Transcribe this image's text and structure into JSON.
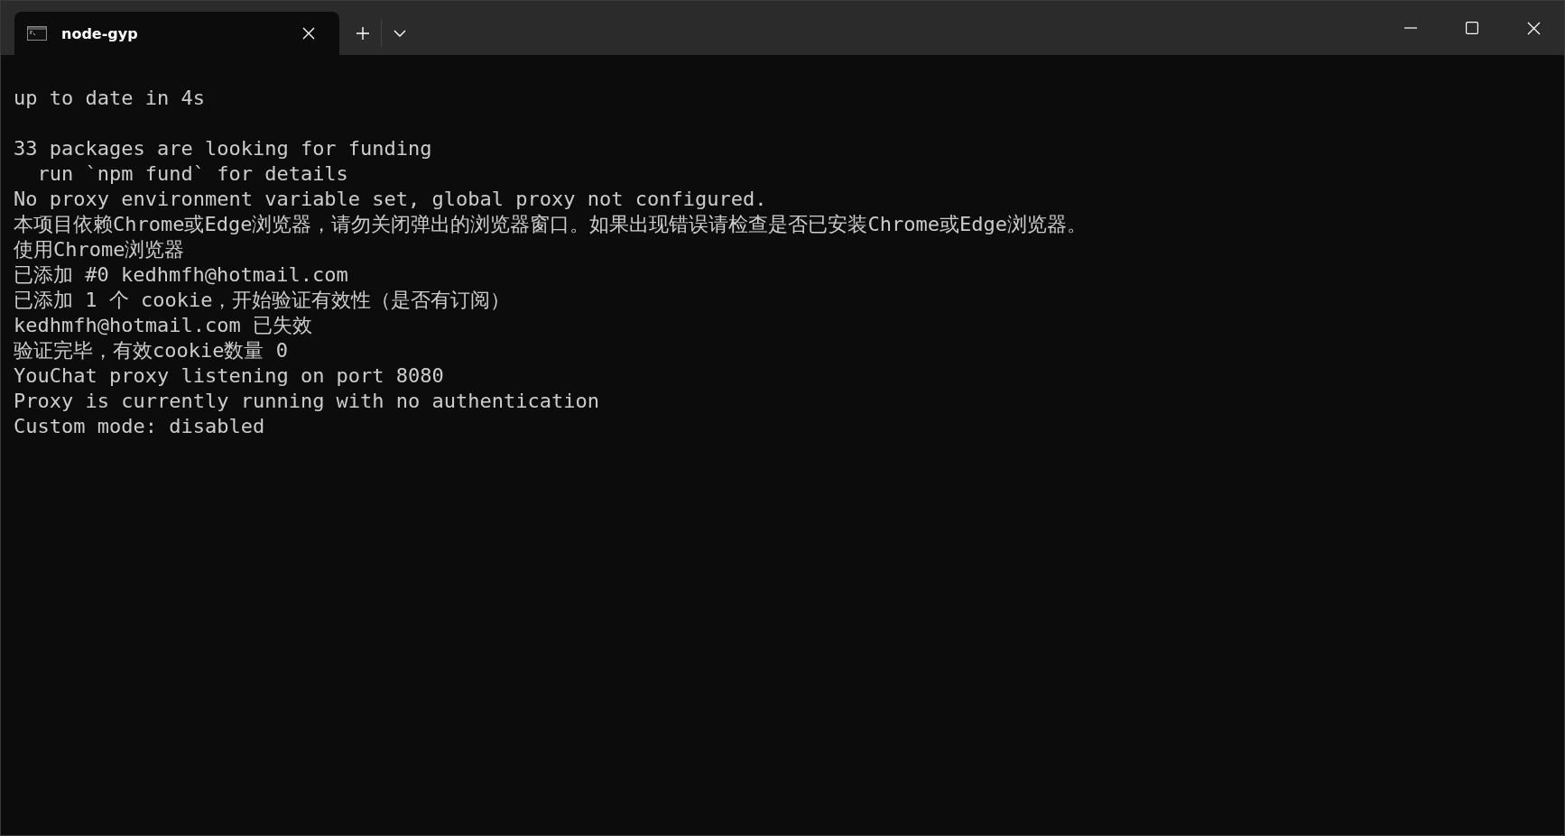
{
  "tabs": [
    {
      "title": "node-gyp",
      "selected": true
    }
  ],
  "output": [
    [
      "up to date in 4s"
    ],
    [
      "33 packages are looking for funding",
      "  run `npm fund` for details",
      "No proxy environment variable set, global proxy not configured.",
      "本项目依赖Chrome或Edge浏览器，请勿关闭弹出的浏览器窗口。如果出现错误请检查是否已安装Chrome或Edge浏览器。",
      "使用Chrome浏览器",
      "已添加 #0 kedhmfh@hotmail.com",
      "已添加 1 个 cookie，开始验证有效性（是否有订阅）",
      "kedhmfh@hotmail.com 已失效",
      "验证完毕，有效cookie数量 0",
      "YouChat proxy listening on port 8080",
      "Proxy is currently running with no authentication",
      "Custom mode: disabled"
    ]
  ]
}
